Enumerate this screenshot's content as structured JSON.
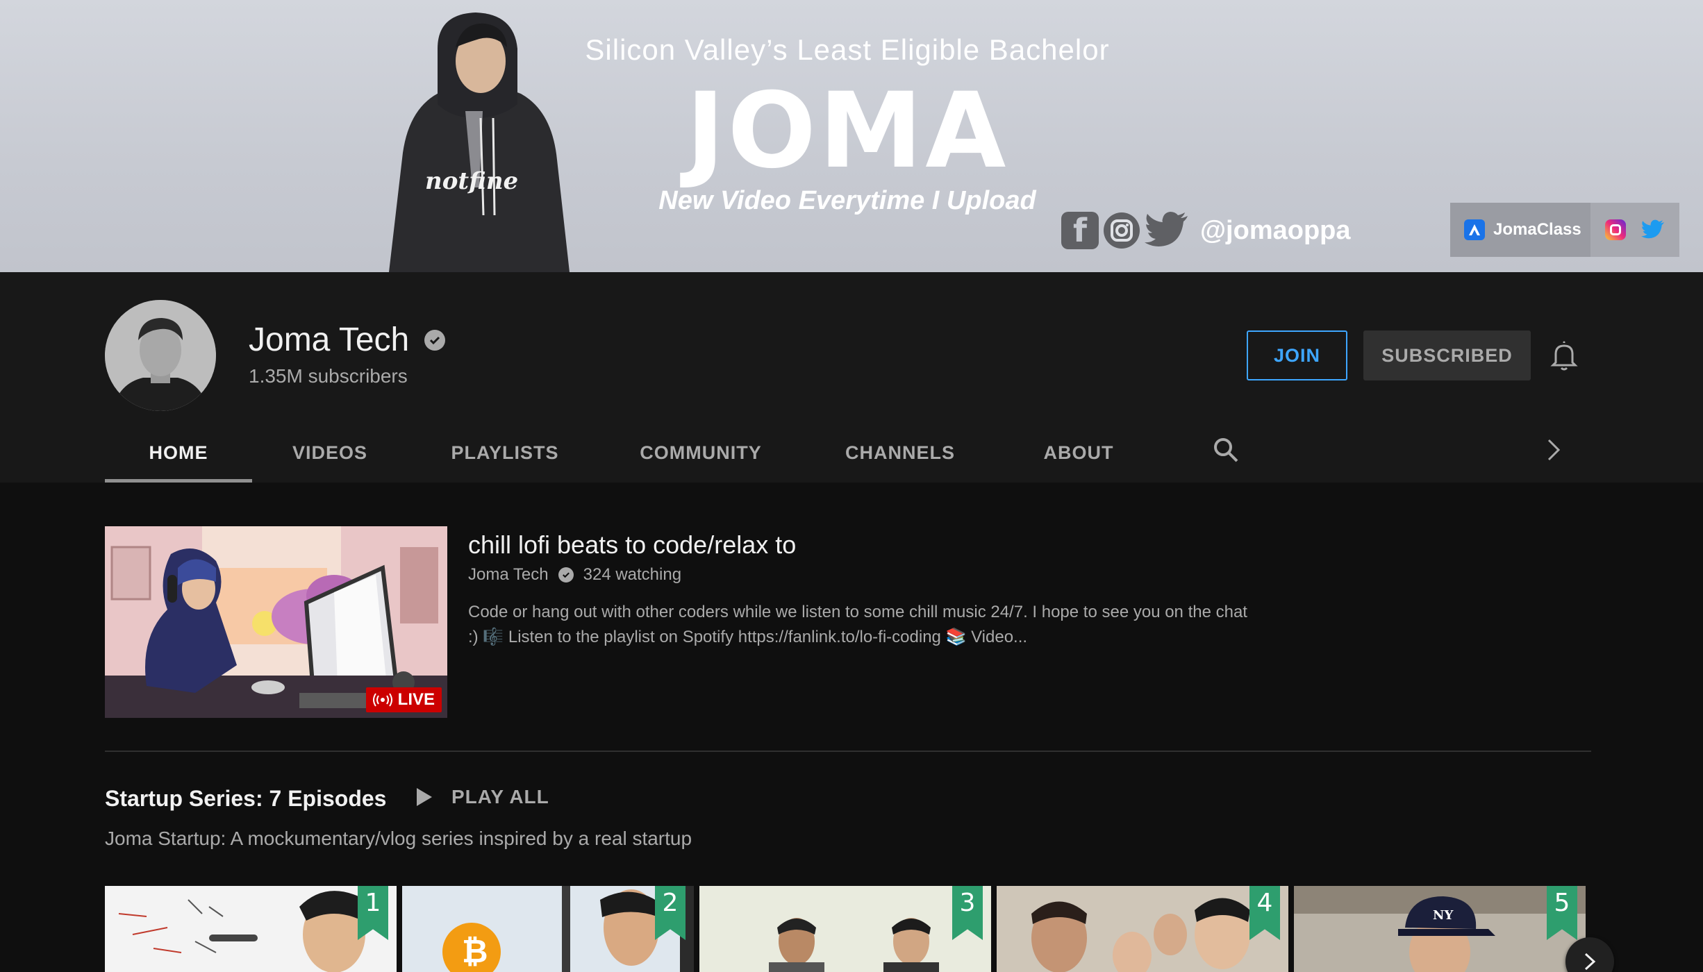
{
  "banner": {
    "tagline": "Silicon Valley’s Least Eligible Bachelor",
    "logo": "JOMA",
    "slogan": "New Video Everytime I Upload",
    "handle": "@jomaoppa",
    "hoodie_text": "notfine",
    "links": {
      "main_label": "JomaClass"
    }
  },
  "channel": {
    "name": "Joma Tech",
    "subscribers": "1.35M subscribers",
    "join_label": "JOIN",
    "subscribed_label": "SUBSCRIBED"
  },
  "tabs": [
    {
      "label": "HOME",
      "active": true
    },
    {
      "label": "VIDEOS"
    },
    {
      "label": "PLAYLISTS"
    },
    {
      "label": "COMMUNITY"
    },
    {
      "label": "CHANNELS"
    },
    {
      "label": "ABOUT"
    }
  ],
  "featured": {
    "title": "chill lofi beats to code/relax to",
    "channel": "Joma Tech",
    "watching": "324 watching",
    "live_label": "LIVE",
    "description_line1": "Code or hang out with other coders while we listen to some chill music 24/7. I hope to see you on the chat",
    "description_line2": ":) 🎼  Listen to the playlist on Spotify https://fanlink.to/lo-fi-coding 📚  Video..."
  },
  "shelf": {
    "title": "Startup Series: 7 Episodes",
    "play_all": "PLAY ALL",
    "subtitle": "Joma Startup: A mockumentary/vlog series inspired by a real startup",
    "episodes": [
      {
        "num": "1"
      },
      {
        "num": "2"
      },
      {
        "num": "3"
      },
      {
        "num": "4"
      },
      {
        "num": "5"
      }
    ]
  },
  "colors": {
    "accent_blue": "#3ea6ff",
    "live_red": "#cc0000",
    "episode_badge": "#2e9e6e"
  }
}
